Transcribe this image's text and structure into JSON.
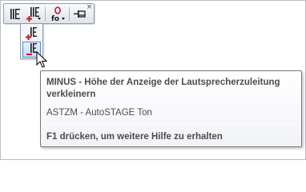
{
  "toolbar": {
    "close_glyph": "×",
    "buttons": [
      {
        "name": "lautsprecher-icon"
      },
      {
        "name": "lautsprecher-plus-icon"
      },
      {
        "name": "fo-o-icon"
      },
      {
        "name": "pin-icon"
      }
    ]
  },
  "flyout": {
    "items": [
      {
        "name": "plus-icon",
        "action": "PLUS"
      },
      {
        "name": "minus-icon",
        "action": "MINUS",
        "selected": true
      }
    ]
  },
  "tooltip": {
    "title": "MINUS - Höhe der Anzeige der Lautsprecherzuleitung verkleinern",
    "description": "ASTZM - AutoSTAGE Ton",
    "help": "F1 drücken, um weitere Hilfe zu erhalten"
  },
  "colors": {
    "accent_red": "#d0102a",
    "icon_dark": "#1a1a1a",
    "highlight_blue": "#5a84c8",
    "tooltip_text": "#4c4c4c"
  }
}
